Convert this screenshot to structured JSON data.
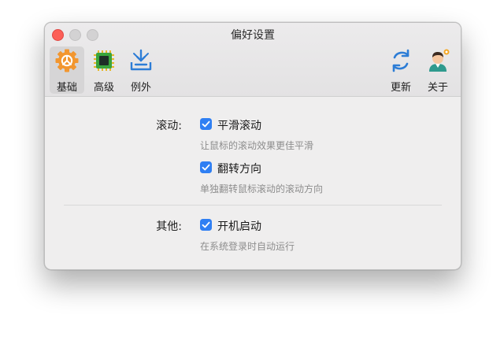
{
  "window": {
    "title": "偏好设置",
    "controls": [
      "close",
      "minimize",
      "zoom"
    ]
  },
  "toolbar": {
    "tabs": [
      {
        "label": "基础",
        "icon": "gear-icon",
        "selected": true
      },
      {
        "label": "高级",
        "icon": "chip-icon",
        "selected": false
      },
      {
        "label": "例外",
        "icon": "download-tray-icon",
        "selected": false
      }
    ],
    "right_items": [
      {
        "label": "更新",
        "icon": "refresh-icon"
      },
      {
        "label": "关于",
        "icon": "person-icon"
      }
    ]
  },
  "sections": {
    "scroll": {
      "label": "滚动:",
      "options": [
        {
          "label": "平滑滚动",
          "desc": "让鼠标的滚动效果更佳平滑",
          "checked": true
        },
        {
          "label": "翻转方向",
          "desc": "单独翻转鼠标滚动的滚动方向",
          "checked": true
        }
      ]
    },
    "other": {
      "label": "其他:",
      "options": [
        {
          "label": "开机启动",
          "desc": "在系统登录时自动运行",
          "checked": true
        }
      ]
    }
  },
  "colors": {
    "accent": "#2f7ff3",
    "gear": "#f2962f",
    "chip": "#3aa53c",
    "tray": "#2d7dd6"
  }
}
